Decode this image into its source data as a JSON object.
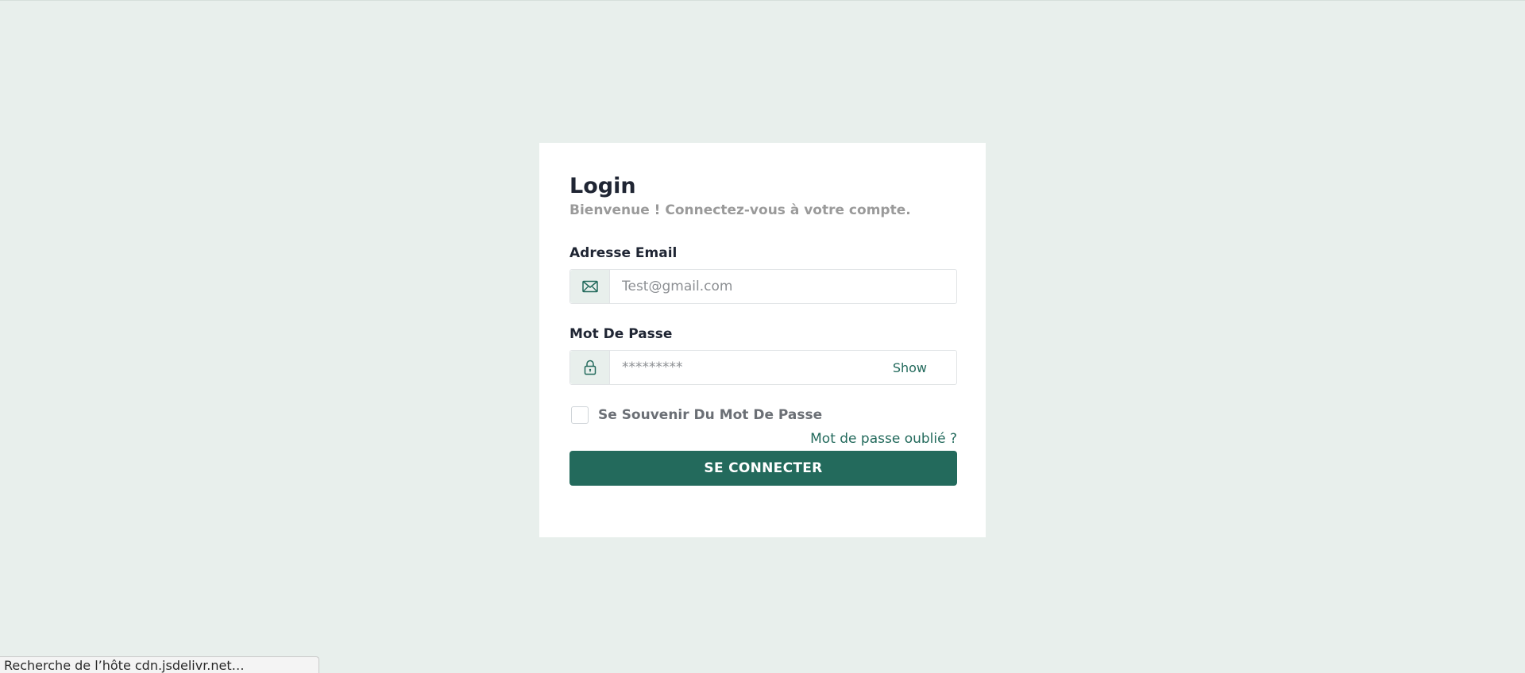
{
  "login": {
    "title": "Login",
    "subtitle": "Bienvenue ! Connectez-vous à votre compte.",
    "email": {
      "label": "Adresse Email",
      "placeholder": "Test@gmail.com",
      "icon": "envelope-icon"
    },
    "password": {
      "label": "Mot De Passe",
      "placeholder": "*********",
      "icon": "lock-icon",
      "show_label": "Show"
    },
    "remember_label": "Se Souvenir Du Mot De Passe",
    "remember_checked": false,
    "forgot_label": "Mot de passe oublié ?",
    "submit_label": "SE CONNECTER"
  },
  "status_bar": {
    "text": "Recherche de l’hôte cdn.jsdelivr.net…"
  },
  "colors": {
    "background": "#e8efec",
    "accent": "#236a5c",
    "card": "#ffffff",
    "title": "#1f2533",
    "muted": "#9a9a9a"
  }
}
